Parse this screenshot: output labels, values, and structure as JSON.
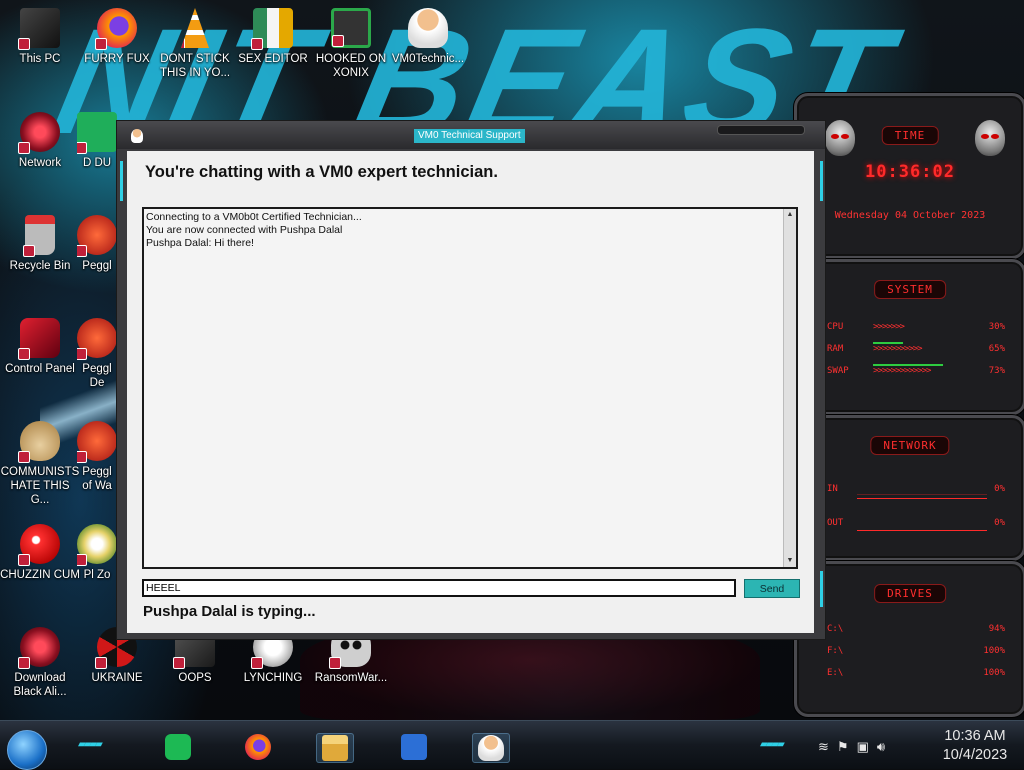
{
  "desktop": {
    "wallpaper_text": "NIT BEAST",
    "icons": [
      {
        "label": "This PC",
        "icon": "this-pc-icon",
        "color": "#222"
      },
      {
        "label": "FURRY FUX",
        "icon": "firefox-icon",
        "color": "#e66000"
      },
      {
        "label": "DONT STICK THIS IN YO...",
        "icon": "vlc-cone-icon",
        "color": "#f08c00"
      },
      {
        "label": "SEX EDITOR",
        "icon": "hxd-editor-icon",
        "color": "#d9a400"
      },
      {
        "label": "HOOKED ON XONIX",
        "icon": "xonix-game-icon",
        "color": "#3a3a3a"
      },
      {
        "label": "VM0Technic...",
        "icon": "technician-avatar-icon",
        "color": "#e0a060"
      },
      {
        "label": "Network",
        "icon": "network-alien-icon",
        "color": "#b02030"
      },
      {
        "label": "Recycle Bin",
        "icon": "recycle-bin-icon",
        "color": "#cc2233"
      },
      {
        "label": "Control Panel",
        "icon": "control-panel-icon",
        "color": "#b01020"
      },
      {
        "label": "COMMUNISTS HATE THIS G...",
        "icon": "money-bag-icon",
        "color": "#caa060"
      },
      {
        "label": "CHUZZIN CUM",
        "icon": "chuzzle-icon",
        "color": "#e02020"
      },
      {
        "label": "Download Black Ali...",
        "icon": "alien-download-icon",
        "color": "#b02030"
      },
      {
        "label": "UKRAINE",
        "icon": "radiation-icon",
        "color": "#d01818"
      },
      {
        "label": "OOPS",
        "icon": "oops-icon",
        "color": "#444"
      },
      {
        "label": "LYNCHING",
        "icon": "lynching-icon",
        "color": "#ddd"
      },
      {
        "label": "RansomWar...",
        "icon": "skull-ransomware-icon",
        "color": "#888"
      }
    ],
    "partial_icons": [
      {
        "label": "D DU",
        "icon": "partial-app-icon"
      },
      {
        "label": "Peggl",
        "icon": "peggle-icon"
      },
      {
        "label": "Peggl De",
        "icon": "peggle-icon"
      },
      {
        "label": "Peggl of Wa",
        "icon": "peggle-icon"
      },
      {
        "label": "Pl Zo",
        "icon": "plants-zombies-icon"
      }
    ]
  },
  "gadgets": {
    "time": {
      "title": "TIME",
      "clock": "10:36:02",
      "date": "Wednesday 04 October 2023"
    },
    "system": {
      "title": "SYSTEM",
      "rows": [
        {
          "label": "CPU",
          "chevrons": ">>>>>>>",
          "value": "30%",
          "percent": 30
        },
        {
          "label": "RAM",
          "chevrons": ">>>>>>>>>>>",
          "value": "65%",
          "percent": 65
        },
        {
          "label": "SWAP",
          "chevrons": ">>>>>>>>>>>>>",
          "value": "73%",
          "percent": 73
        }
      ]
    },
    "network": {
      "title": "NETWORK",
      "rows": [
        {
          "label": "IN",
          "value": "0%"
        },
        {
          "label": "OUT",
          "value": "0%"
        }
      ]
    },
    "drives": {
      "title": "DRIVES",
      "rows": [
        {
          "label": "C:\\",
          "value": "94%"
        },
        {
          "label": "F:\\",
          "value": "100%"
        },
        {
          "label": "E:\\",
          "value": "100%"
        }
      ]
    }
  },
  "chat_window": {
    "title": "VM0 Technical Support",
    "heading": "You're chatting with a VM0 expert technician.",
    "messages": [
      "Connecting to a VM0b0t Certified Technician...",
      "You are now connected with Pushpa Dalal",
      "Pushpa Dalal: Hi there!"
    ],
    "input_value": "HEEEL",
    "send_label": "Send",
    "typing_status": "Pushpa Dalal is typing..."
  },
  "taskbar": {
    "apps": [
      {
        "name": "spotify",
        "icon": "spotify-icon",
        "color": "#1db954"
      },
      {
        "name": "firefox",
        "icon": "firefox-icon",
        "color": "#e66000"
      },
      {
        "name": "file-explorer",
        "icon": "folder-icon",
        "color": "#e8b84a"
      },
      {
        "name": "garrys-mod",
        "icon": "gmod-icon",
        "color": "#2c6fd6"
      },
      {
        "name": "vm0-support",
        "icon": "technician-avatar-icon",
        "color": "#e0a060"
      }
    ],
    "tray_icons": [
      "show-desktop-icon",
      "flag-icon",
      "network-tray-icon",
      "volume-icon"
    ],
    "clock_time": "10:36 AM",
    "clock_date": "10/4/2023"
  },
  "colors": {
    "accent_cyan": "#2bb6c9",
    "gadget_red": "#ff2a2a",
    "send_button": "#2cb5b3"
  }
}
